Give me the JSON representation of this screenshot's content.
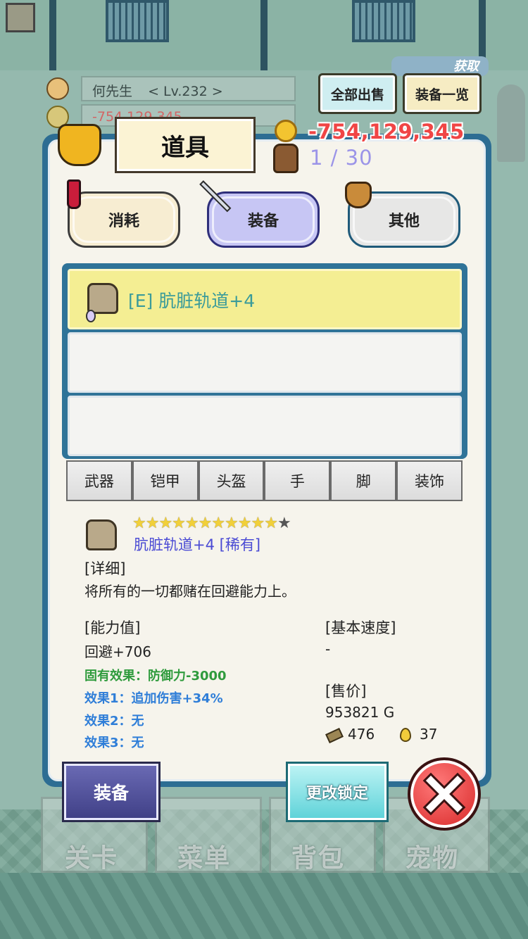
{
  "hud": {
    "player": "何先生",
    "level": "< Lv.232 >",
    "gold_faded": "-754,129,345",
    "sell_all": "全部出售",
    "equip_list": "装备一览",
    "get_label": "获取"
  },
  "panel": {
    "title": "道具",
    "gold": "-754,129,345",
    "capacity": "1 / 30"
  },
  "categories": [
    {
      "label": "消耗",
      "color": "#f7edd2",
      "active": false
    },
    {
      "label": "装备",
      "color": "#c7c6f4",
      "active": true
    },
    {
      "label": "其他",
      "color": "#e7e7e6",
      "active": false
    }
  ],
  "items": [
    {
      "label": "[E] 肮脏轨道+4",
      "selected": true
    },
    {
      "label": "",
      "selected": false
    },
    {
      "label": "",
      "selected": false
    }
  ],
  "filters": [
    "武器",
    "铠甲",
    "头盔",
    "手",
    "脚",
    "装饰"
  ],
  "detail": {
    "stars_filled": "★★★★★★★★★★★",
    "stars_empty": "★",
    "stars_filled_count": 11,
    "stars_total": 12,
    "name": "肮脏轨道+4 [稀有]",
    "detail_head": "[详细]",
    "description": "将所有的一切都赌在回避能力上。",
    "stats_head": "[能力值]",
    "stat": "回避+706",
    "innate": "固有效果：防御力-3000",
    "effect1": "效果1：追加伤害+34%",
    "effect2": "效果2：无",
    "effect3": "效果3：无",
    "speed_head": "[基本速度]",
    "speed": "-",
    "price_head": "[售价]",
    "price": "953821 G",
    "mat1": "476",
    "mat2": "37"
  },
  "nav": [
    "关卡",
    "菜单",
    "背包",
    "宠物"
  ],
  "actions": {
    "equip": "装备",
    "lock": "更改锁定"
  },
  "colors": {
    "panel_border": "#2d6d93",
    "selected_item": "#f4ee93",
    "gold_red": "#f04545",
    "innate_green": "#2f9b3d",
    "effect_blue": "#2f7ed8"
  }
}
